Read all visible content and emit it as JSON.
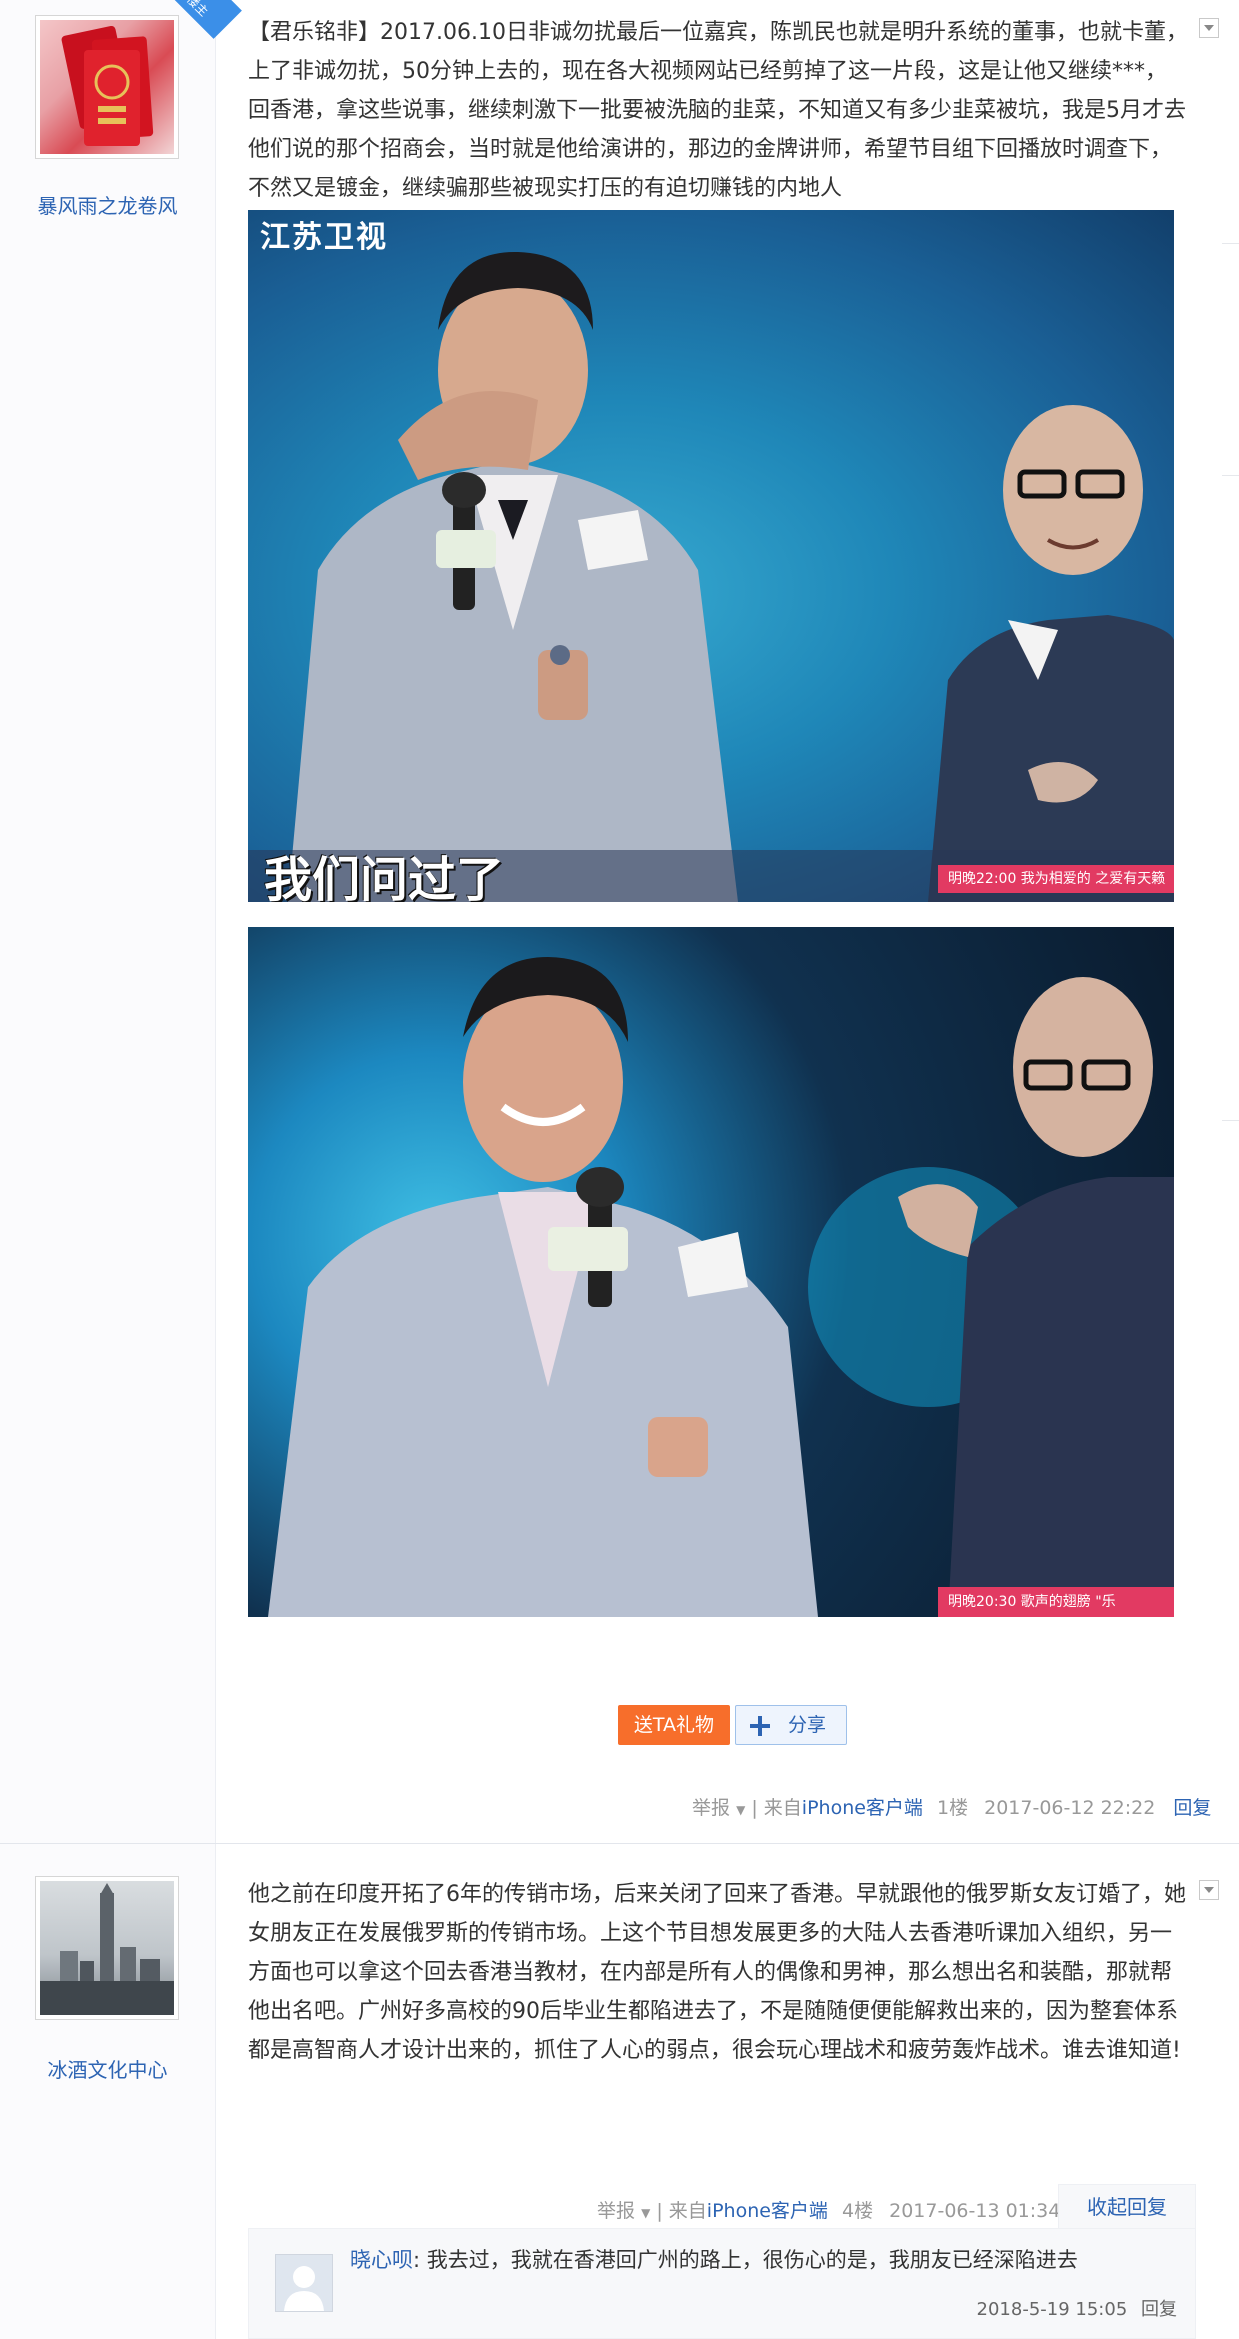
{
  "post1": {
    "username": "暴风雨之龙卷风",
    "badge": "楼主",
    "content": "【君乐铭非】2017.06.10日非诚勿扰最后一位嘉宾，陈凯民也就是明升系统的董事，也就卡董，上了非诚勿扰，50分钟上去的，现在各大视频网站已经剪掉了这一片段，这是让他又继续***，回香港，拿这些说事，继续刺激下一批要被洗脑的韭菜，不知道又有多少韭菜被坑，我是5月才去他们说的那个招商会，当时就是他给演讲的，那边的金牌讲师，希望节目组下回播放时调查下，不然又是镀金，继续骗那些被现实打压的有迫切赚钱的内地人",
    "photo1": {
      "channel_logo": "江苏卫视",
      "subtitle": "我们问过了",
      "ticker": "明晚22:00 我为相爱的 之爱有天籁"
    },
    "photo2": {
      "ticker": "明晚20:30 歌声的翅膀 \"乐"
    },
    "gift_button": "送TA礼物",
    "share_button": "分享",
    "tail": {
      "report": "举报",
      "source_prefix": "| 来自",
      "source": "iPhone客户端",
      "floor": "1楼",
      "time": "2017-06-12 22:22",
      "reply": "回复"
    }
  },
  "post2": {
    "username": "冰酒文化中心",
    "content": "他之前在印度开拓了6年的传销市场，后来关闭了回来了香港。早就跟他的俄罗斯女友订婚了，她女朋友正在发展俄罗斯的传销市场。上这个节目想发展更多的大陆人去香港听课加入组织，另一方面也可以拿这个回去香港当教材，在内部是所有人的偶像和男神，那么想出名和装酷，那就帮他出名吧。广州好多高校的90后毕业生都陷进去了，不是随随便便能解救出来的，因为整套体系都是高智商人才设计出来的，抓住了人心的弱点，很会玩心理战术和疲劳轰炸战术。谁去谁知道!",
    "tail": {
      "report": "举报",
      "source_prefix": "| 来自",
      "source": "iPhone客户端",
      "floor": "4楼",
      "time": "2017-06-13 01:34",
      "collapse": "收起回复"
    },
    "sub_reply": {
      "user": "晓心呗",
      "text": ": 我去过，我就在香港回广州的路上，很伤心的是，我朋友已经深陷进去",
      "time": "2018-5-19 15:05",
      "reply": "回复"
    }
  },
  "colors": {
    "link": "#2d64b3",
    "gift": "#f76e2b",
    "badge": "#3b8fe8",
    "meta": "#999999"
  },
  "icons": [
    "chevron-down-icon",
    "plus-icon",
    "dropdown-caret-icon",
    "user-placeholder-icon"
  ]
}
